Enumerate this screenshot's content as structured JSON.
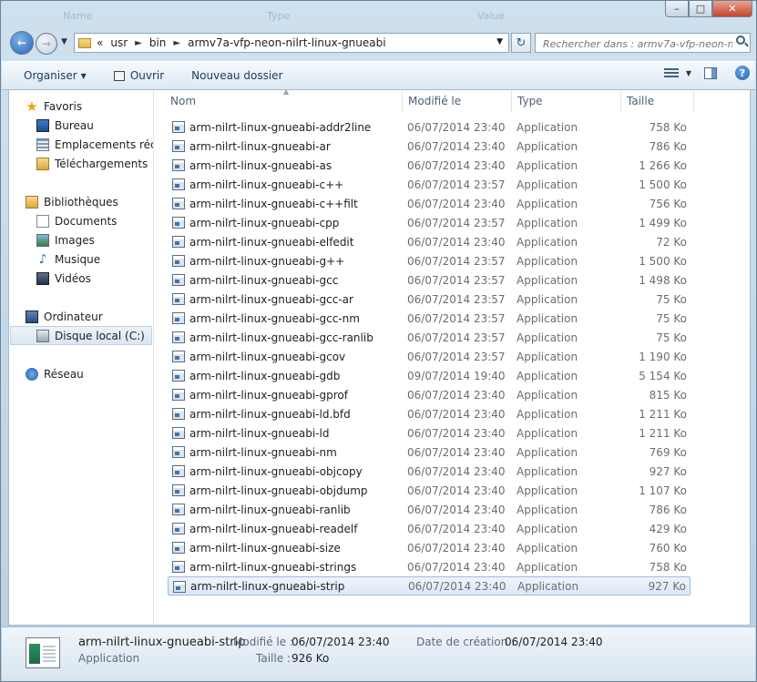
{
  "window": {
    "ghost_headers": [
      "Name",
      "Type",
      "Value"
    ],
    "controls": {
      "minimize": "–",
      "maximize": "□",
      "close": "✕"
    }
  },
  "address": {
    "crumbs": [
      "usr",
      "bin",
      "armv7a-vfp-neon-nilrt-linux-gnueabi"
    ],
    "overflow": "«",
    "separator": "►"
  },
  "search": {
    "placeholder": "Rechercher dans : armv7a-vfp-neon-n..."
  },
  "toolbar": {
    "organize_label": "Organiser",
    "open_label": "Ouvrir",
    "new_folder_label": "Nouveau dossier",
    "help_label": "?"
  },
  "sidebar": {
    "favorites": {
      "label": "Favoris",
      "items": [
        {
          "label": "Bureau"
        },
        {
          "label": "Emplacements récents"
        },
        {
          "label": "Téléchargements"
        }
      ]
    },
    "libraries": {
      "label": "Bibliothèques",
      "items": [
        {
          "label": "Documents"
        },
        {
          "label": "Images"
        },
        {
          "label": "Musique"
        },
        {
          "label": "Vidéos"
        }
      ]
    },
    "computer": {
      "label": "Ordinateur",
      "items": [
        {
          "label": "Disque local (C:)",
          "selected": true
        }
      ]
    },
    "network": {
      "label": "Réseau"
    }
  },
  "columns": {
    "name": "Nom",
    "modified": "Modifié le",
    "type": "Type",
    "size": "Taille"
  },
  "files": [
    {
      "name": "arm-nilrt-linux-gnueabi-addr2line",
      "modified": "06/07/2014 23:40",
      "type": "Application",
      "size": "758 Ko"
    },
    {
      "name": "arm-nilrt-linux-gnueabi-ar",
      "modified": "06/07/2014 23:40",
      "type": "Application",
      "size": "786 Ko"
    },
    {
      "name": "arm-nilrt-linux-gnueabi-as",
      "modified": "06/07/2014 23:40",
      "type": "Application",
      "size": "1 266 Ko"
    },
    {
      "name": "arm-nilrt-linux-gnueabi-c++",
      "modified": "06/07/2014 23:57",
      "type": "Application",
      "size": "1 500 Ko"
    },
    {
      "name": "arm-nilrt-linux-gnueabi-c++filt",
      "modified": "06/07/2014 23:40",
      "type": "Application",
      "size": "756 Ko"
    },
    {
      "name": "arm-nilrt-linux-gnueabi-cpp",
      "modified": "06/07/2014 23:57",
      "type": "Application",
      "size": "1 499 Ko"
    },
    {
      "name": "arm-nilrt-linux-gnueabi-elfedit",
      "modified": "06/07/2014 23:40",
      "type": "Application",
      "size": "72 Ko"
    },
    {
      "name": "arm-nilrt-linux-gnueabi-g++",
      "modified": "06/07/2014 23:57",
      "type": "Application",
      "size": "1 500 Ko"
    },
    {
      "name": "arm-nilrt-linux-gnueabi-gcc",
      "modified": "06/07/2014 23:57",
      "type": "Application",
      "size": "1 498 Ko"
    },
    {
      "name": "arm-nilrt-linux-gnueabi-gcc-ar",
      "modified": "06/07/2014 23:57",
      "type": "Application",
      "size": "75 Ko"
    },
    {
      "name": "arm-nilrt-linux-gnueabi-gcc-nm",
      "modified": "06/07/2014 23:57",
      "type": "Application",
      "size": "75 Ko"
    },
    {
      "name": "arm-nilrt-linux-gnueabi-gcc-ranlib",
      "modified": "06/07/2014 23:57",
      "type": "Application",
      "size": "75 Ko"
    },
    {
      "name": "arm-nilrt-linux-gnueabi-gcov",
      "modified": "06/07/2014 23:57",
      "type": "Application",
      "size": "1 190 Ko"
    },
    {
      "name": "arm-nilrt-linux-gnueabi-gdb",
      "modified": "09/07/2014 19:40",
      "type": "Application",
      "size": "5 154 Ko"
    },
    {
      "name": "arm-nilrt-linux-gnueabi-gprof",
      "modified": "06/07/2014 23:40",
      "type": "Application",
      "size": "815 Ko"
    },
    {
      "name": "arm-nilrt-linux-gnueabi-ld.bfd",
      "modified": "06/07/2014 23:40",
      "type": "Application",
      "size": "1 211 Ko"
    },
    {
      "name": "arm-nilrt-linux-gnueabi-ld",
      "modified": "06/07/2014 23:40",
      "type": "Application",
      "size": "1 211 Ko"
    },
    {
      "name": "arm-nilrt-linux-gnueabi-nm",
      "modified": "06/07/2014 23:40",
      "type": "Application",
      "size": "769 Ko"
    },
    {
      "name": "arm-nilrt-linux-gnueabi-objcopy",
      "modified": "06/07/2014 23:40",
      "type": "Application",
      "size": "927 Ko"
    },
    {
      "name": "arm-nilrt-linux-gnueabi-objdump",
      "modified": "06/07/2014 23:40",
      "type": "Application",
      "size": "1 107 Ko"
    },
    {
      "name": "arm-nilrt-linux-gnueabi-ranlib",
      "modified": "06/07/2014 23:40",
      "type": "Application",
      "size": "786 Ko"
    },
    {
      "name": "arm-nilrt-linux-gnueabi-readelf",
      "modified": "06/07/2014 23:40",
      "type": "Application",
      "size": "429 Ko"
    },
    {
      "name": "arm-nilrt-linux-gnueabi-size",
      "modified": "06/07/2014 23:40",
      "type": "Application",
      "size": "760 Ko"
    },
    {
      "name": "arm-nilrt-linux-gnueabi-strings",
      "modified": "06/07/2014 23:40",
      "type": "Application",
      "size": "758 Ko"
    },
    {
      "name": "arm-nilrt-linux-gnueabi-strip",
      "modified": "06/07/2014 23:40",
      "type": "Application",
      "size": "927 Ko",
      "selected": true
    }
  ],
  "details": {
    "name": "arm-nilrt-linux-gnueabi-strip",
    "type": "Application",
    "modified_label": "Modifié le :",
    "modified_value": "06/07/2014 23:40",
    "size_label": "Taille :",
    "size_value": "926 Ko",
    "created_label": "Date de création :",
    "created_value": "06/07/2014 23:40"
  },
  "colors": {
    "selection_bg": "#dce8f5",
    "selection_border": "#9dbbe0",
    "toolbar_text": "#1e395b"
  }
}
